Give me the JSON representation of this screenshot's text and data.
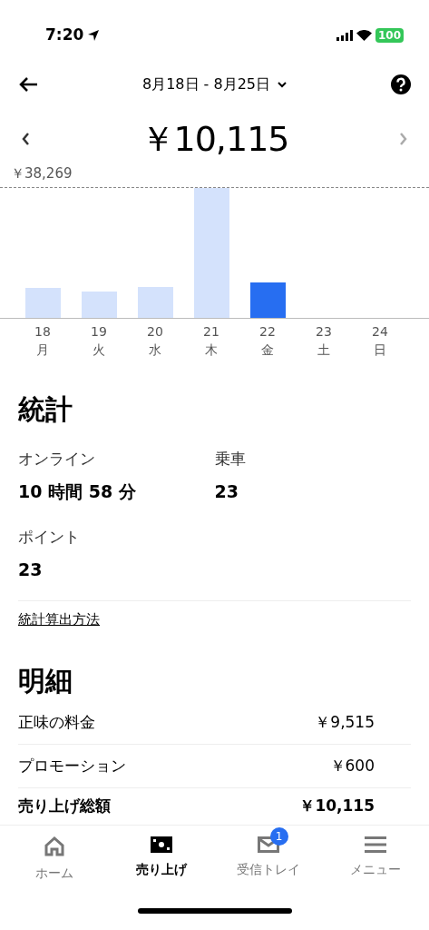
{
  "status_bar": {
    "time": "7:20",
    "battery": "100"
  },
  "header": {
    "date_range": "8月18日 - 8月25日"
  },
  "total": "￥10,115",
  "chart": {
    "max_label": "￥38,269",
    "days": [
      {
        "date": "18",
        "weekday": "月",
        "selected": false
      },
      {
        "date": "19",
        "weekday": "火",
        "selected": false
      },
      {
        "date": "20",
        "weekday": "水",
        "selected": false
      },
      {
        "date": "21",
        "weekday": "木",
        "selected": false
      },
      {
        "date": "22",
        "weekday": "金",
        "selected": true
      },
      {
        "date": "23",
        "weekday": "土",
        "selected": false
      },
      {
        "date": "24",
        "weekday": "日",
        "selected": false
      }
    ]
  },
  "stats": {
    "title": "統計",
    "items": [
      {
        "label": "オンライン",
        "value": "10 時間 58 分"
      },
      {
        "label": "乗車",
        "value": "23"
      },
      {
        "label": "ポイント",
        "value": "23"
      }
    ],
    "link": "統計算出方法"
  },
  "details": {
    "title": "明細",
    "rows": [
      {
        "label": "正味の料金",
        "amount": "￥9,515",
        "bold": false
      },
      {
        "label": "プロモーション",
        "amount": "￥600",
        "bold": false
      },
      {
        "label": "売り上げ総額",
        "amount": "￥10,115",
        "bold": true
      }
    ]
  },
  "tab_bar": [
    {
      "kind": "home",
      "label": "ホーム",
      "selected": false
    },
    {
      "kind": "earnings",
      "label": "売り上げ",
      "selected": true
    },
    {
      "kind": "inbox",
      "label": "受信トレイ",
      "selected": false,
      "badge": "1"
    },
    {
      "kind": "menu",
      "label": "メニュー",
      "selected": false
    }
  ]
}
